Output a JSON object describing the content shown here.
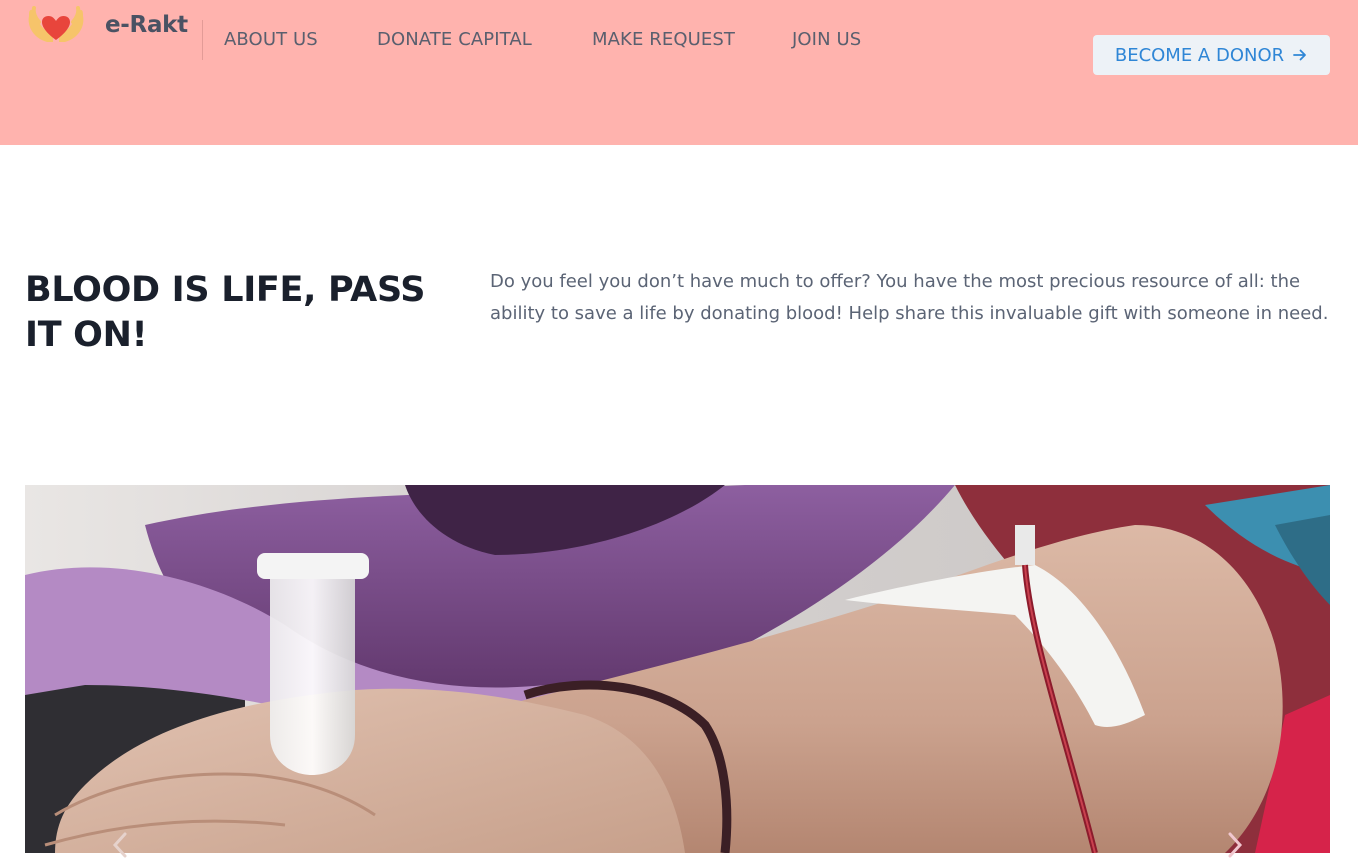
{
  "header": {
    "brand": "e-Rakt",
    "logo_icon": "hands-heart-icon",
    "nav": [
      {
        "label": "ABOUT US"
      },
      {
        "label": "DONATE CAPITAL"
      },
      {
        "label": "MAKE REQUEST"
      },
      {
        "label": "JOIN US"
      }
    ],
    "cta": {
      "label": "BECOME A DONOR",
      "icon": "arrow-right-icon"
    },
    "colors": {
      "background": "#ffb3ae",
      "cta_background": "#edf2f7",
      "cta_text": "#2f86d6"
    }
  },
  "hero": {
    "headline": "BLOOD IS LIFE, PASS IT ON!",
    "intro": "Do you feel you don’t have much to offer? You have the most precious resource of all: the ability to save a life by donating blood! Help share this invaluable gift with someone in need."
  },
  "carousel": {
    "image_icon": "blood-donation-photo",
    "prev_icon": "chevron-left-icon",
    "next_icon": "chevron-right-icon"
  }
}
